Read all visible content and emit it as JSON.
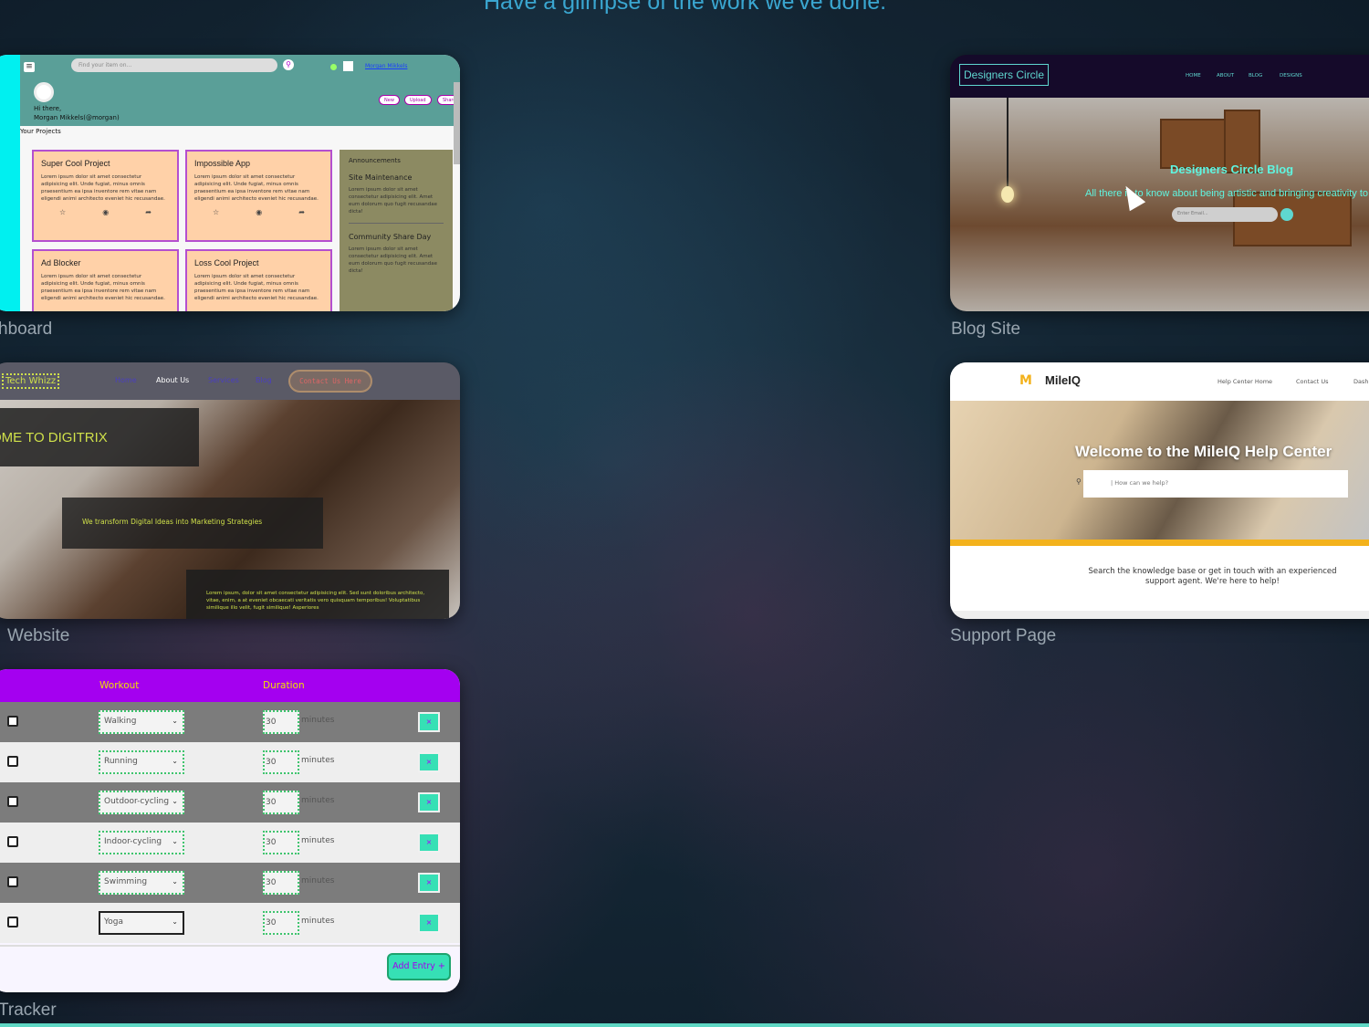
{
  "heading": "Have a glimpse of the work we've done.",
  "captions": {
    "dashboard": "hboard",
    "agency": "Website",
    "tracker": "Tracker",
    "blog": "Blog Site",
    "support": "Support Page"
  },
  "dashboard": {
    "search_placeholder": "Find your item on...",
    "user_link": "Morgan Mikkels",
    "greeting_line1": "Hi there,",
    "greeting_line2": "Morgan Mikkels(@morgan)",
    "pills": [
      "New",
      "Upload",
      "Share"
    ],
    "projects_label": "Your Projects",
    "lorem": "Lorem ipsum dolor sit amet consectetur adipisicing elit. Unde fugiat, minus omnis praesentium ea ipsa inventore rem vitae nam eligendi animi architecto eveniet hic recusandae.",
    "projects": [
      {
        "title": "Super Cool Project"
      },
      {
        "title": "Impossible App"
      },
      {
        "title": "Ad Blocker"
      },
      {
        "title": "Loss Cool Project"
      }
    ],
    "announcements_title": "Announcements",
    "announcements": [
      {
        "title": "Site Maintenance",
        "body": "Lorem ipsum dolor sit amet consectetur adipisicing elit. Amet eum dolorum quo fugit recusandae dicta!"
      },
      {
        "title": "Community Share Day",
        "body": "Lorem ipsum dolor sit amet consectetur adipisicing elit. Amet eum dolorum quo fugit recusandae dicta!"
      }
    ]
  },
  "agency": {
    "logo": "Tech Whizz",
    "nav": [
      "Home",
      "About Us",
      "Services",
      "Blog"
    ],
    "contact": "Contact Us Here",
    "welcome": "OME TO DIGITRIX",
    "tagline": "We transform Digital Ideas into Marketing Strategies",
    "body": "Lorem ipsum, dolor sit amet consectetur adipisicing elit. Sed sunt doloribus architecto, vitae, enim, a at eveniet obcaecati veritatis vero quisquam temporibus! Voluptatibus similique illo velit, fugit similique! Asperiores"
  },
  "tracker": {
    "col_workout": "Workout",
    "col_duration": "Duration",
    "unit": "minutes",
    "rows": [
      {
        "workout": "Walking",
        "duration": "30"
      },
      {
        "workout": "Running",
        "duration": "30"
      },
      {
        "workout": "Outdoor-cycling",
        "duration": "30"
      },
      {
        "workout": "Indoor-cycling",
        "duration": "30"
      },
      {
        "workout": "Swimming",
        "duration": "30"
      },
      {
        "workout": "Yoga",
        "duration": "30"
      }
    ],
    "delete_label": "×",
    "add_label": "Add Entry +"
  },
  "blog": {
    "logo": "Designers Circle",
    "nav": [
      "HOME",
      "ABOUT",
      "BLOG",
      "DESIGNS"
    ],
    "title": "Designers Circle Blog",
    "subtitle": "All there is to know about being artistic and bringing creativity to li",
    "search_placeholder": "Enter Email..."
  },
  "support": {
    "logo": "MileIQ",
    "nav": [
      "Help Center Home",
      "Contact Us",
      "Dash"
    ],
    "hero_title": "Welcome to the MileIQ Help Center",
    "search_placeholder": "| How can we help?",
    "body": "Search the knowledge base or get in touch with an experienced support agent. We're here to help!"
  }
}
